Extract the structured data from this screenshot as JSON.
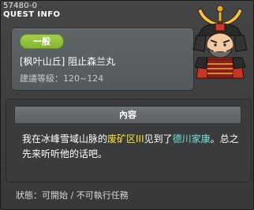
{
  "window": {
    "quest_id": "57480-0",
    "title": "QUEST INFO"
  },
  "header": {
    "category_badge": "一般",
    "quest_name": "[枫叶山丘] 阻止森兰丸",
    "level_label": "建議等級：",
    "level_range": "120~124"
  },
  "portrait": {
    "name": "samurai-warlord-portrait"
  },
  "content": {
    "header_label": "內容",
    "description": {
      "part1": "我在冰峰雪域山脉的",
      "location": "废矿区III",
      "part2": "见到了",
      "npc": "德川家康",
      "part3": "。总之先来听听他的话吧。"
    }
  },
  "status": {
    "label": "狀態：",
    "value": "可開始 / 不可執行任務"
  },
  "colors": {
    "badge_green": "#98c43f",
    "location_yellow": "#ffe13a",
    "npc_cyan": "#6fe3d8"
  }
}
